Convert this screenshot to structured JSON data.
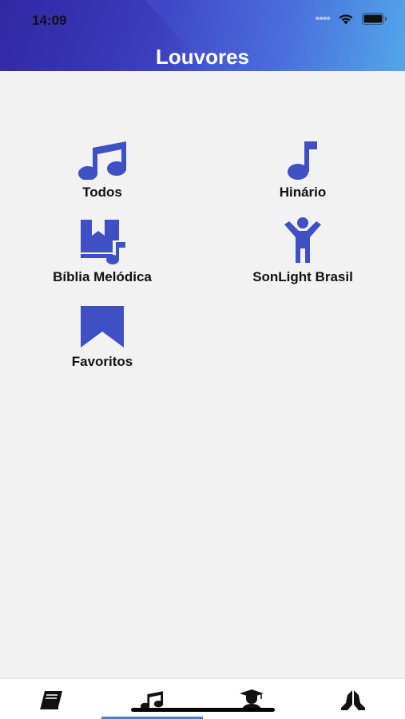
{
  "status_bar": {
    "time": "14:09"
  },
  "header": {
    "title": "Louvores"
  },
  "tiles": [
    {
      "label": "Todos",
      "icon": "music-notes-icon"
    },
    {
      "label": "Hinário",
      "icon": "music-note-icon"
    },
    {
      "label": "Bíblia Melódica",
      "icon": "bible-music-icon"
    },
    {
      "label": "SonLight Brasil",
      "icon": "child-icon"
    },
    {
      "label": "Favoritos",
      "icon": "bookmark-icon"
    }
  ],
  "tab_bar": {
    "items": [
      {
        "icon": "book-icon"
      },
      {
        "icon": "music-notes-icon"
      },
      {
        "icon": "graduate-icon"
      },
      {
        "icon": "praying-hands-icon"
      }
    ],
    "active_index": 1
  },
  "colors": {
    "accent": "#3f4fc4",
    "tab_active": "#2f8ae6"
  }
}
